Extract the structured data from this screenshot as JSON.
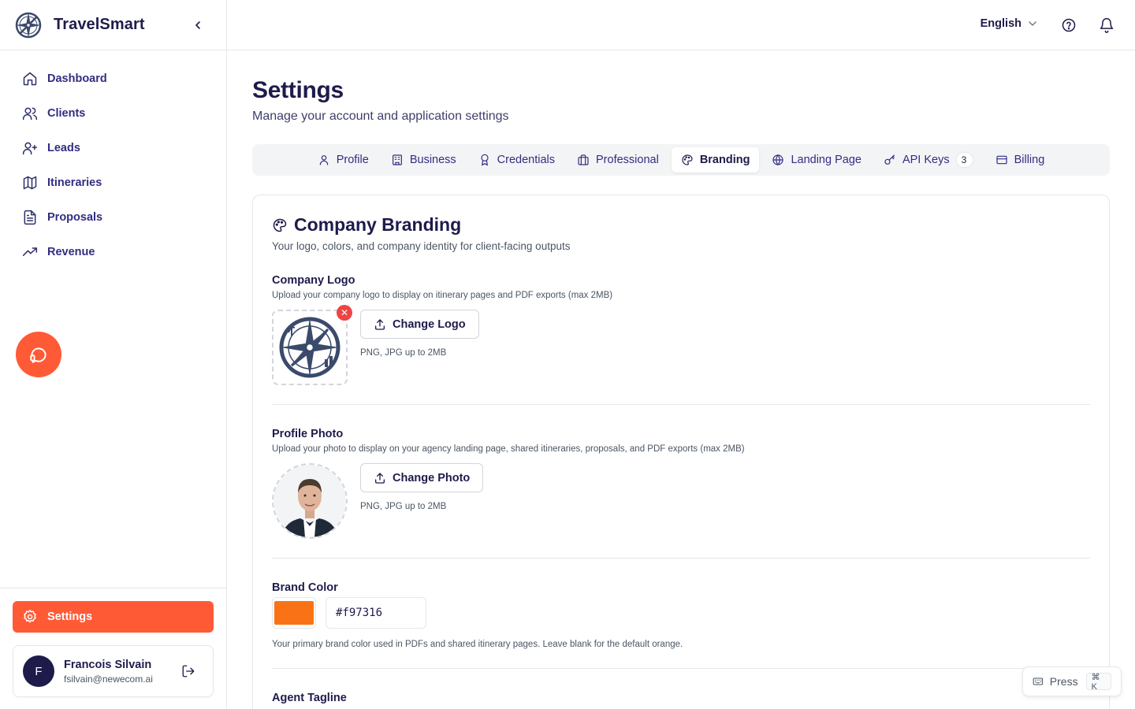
{
  "app": {
    "name": "TravelSmart"
  },
  "sidebar": {
    "items": [
      {
        "label": "Dashboard",
        "icon": "home-icon"
      },
      {
        "label": "Clients",
        "icon": "users-icon"
      },
      {
        "label": "Leads",
        "icon": "user-plus-icon"
      },
      {
        "label": "Itineraries",
        "icon": "map-icon"
      },
      {
        "label": "Proposals",
        "icon": "file-text-icon"
      },
      {
        "label": "Revenue",
        "icon": "trending-up-icon"
      }
    ],
    "settings_label": "Settings",
    "user": {
      "initial": "F",
      "name": "Francois Silvain",
      "email": "fsilvain@newecom.ai"
    }
  },
  "topbar": {
    "language": "English"
  },
  "page": {
    "title": "Settings",
    "subtitle": "Manage your account and application settings"
  },
  "tabs": [
    {
      "label": "Profile",
      "icon": "user-icon"
    },
    {
      "label": "Business",
      "icon": "building-icon"
    },
    {
      "label": "Credentials",
      "icon": "award-icon"
    },
    {
      "label": "Professional",
      "icon": "briefcase-icon"
    },
    {
      "label": "Branding",
      "icon": "palette-icon",
      "active": true
    },
    {
      "label": "Landing Page",
      "icon": "globe-icon"
    },
    {
      "label": "API Keys",
      "icon": "key-icon",
      "badge": "3"
    },
    {
      "label": "Billing",
      "icon": "credit-card-icon"
    }
  ],
  "branding": {
    "title": "Company Branding",
    "subtitle": "Your logo, colors, and company identity for client-facing outputs",
    "logo": {
      "title": "Company Logo",
      "desc": "Upload your company logo to display on itinerary pages and PDF exports (max 2MB)",
      "button": "Change Logo",
      "hint": "PNG, JPG up to 2MB"
    },
    "photo": {
      "title": "Profile Photo",
      "desc": "Upload your photo to display on your agency landing page, shared itineraries, proposals, and PDF exports (max 2MB)",
      "button": "Change Photo",
      "hint": "PNG, JPG up to 2MB"
    },
    "color": {
      "title": "Brand Color",
      "value": "#f97316",
      "desc": "Your primary brand color used in PDFs and shared itinerary pages. Leave blank for the default orange."
    },
    "tagline": {
      "title": "Agent Tagline"
    }
  },
  "shortcut": {
    "press": "Press",
    "keys": "⌘ K"
  },
  "colors": {
    "accent": "#ff5a36",
    "brand": "#f97316",
    "navy": "#1e1b4b",
    "danger": "#ef4444"
  }
}
